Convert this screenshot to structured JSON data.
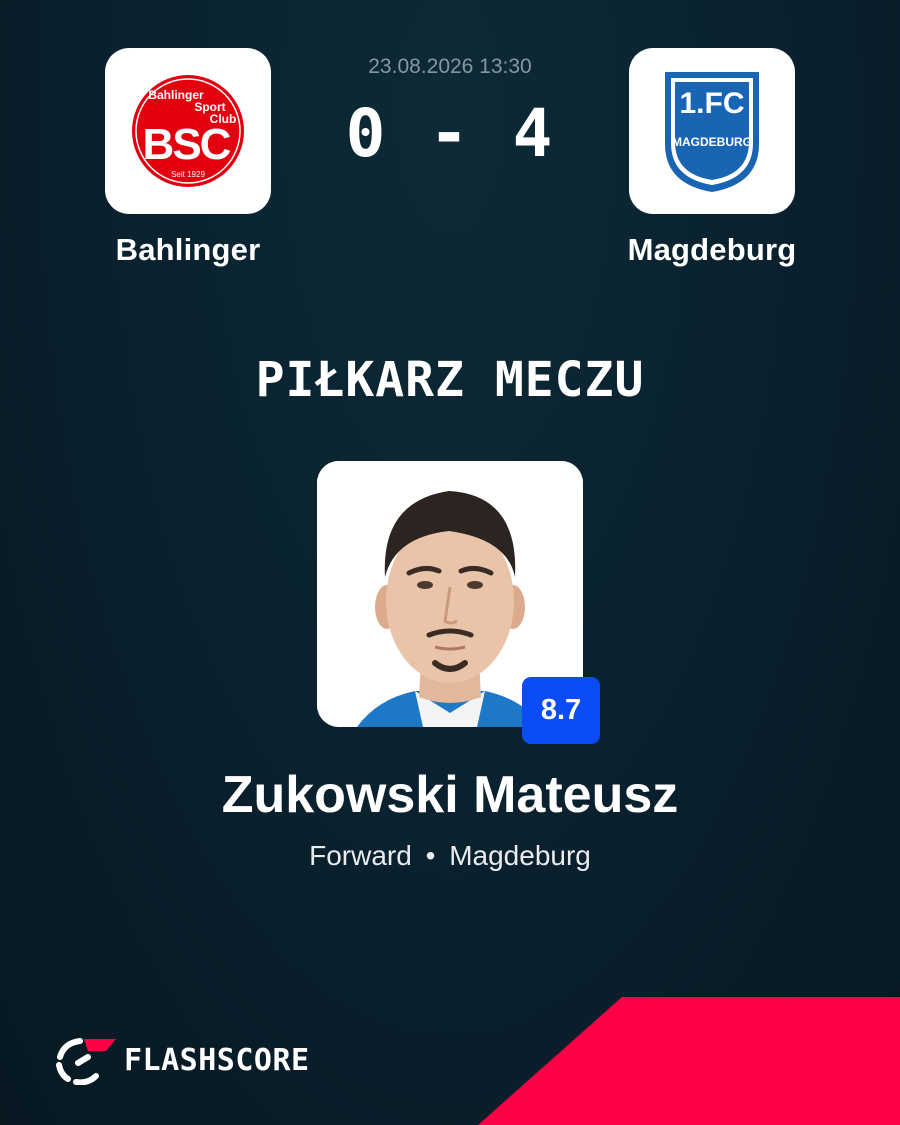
{
  "match": {
    "datetime": "23.08.2026 13:30",
    "score": "0 - 4",
    "home": {
      "name": "Bahlinger",
      "logo_top": "Bahlinger",
      "logo_sport": "Sport",
      "logo_club": "Club",
      "logo_letters": "BSC",
      "logo_bottom": "Seit 1929",
      "color": "#e3000f"
    },
    "away": {
      "name": "Magdeburg",
      "logo_top": "1.FC",
      "logo_side": "MAGDEBURG",
      "color": "#1a64b4"
    }
  },
  "title": "PIŁKARZ MECZU",
  "player": {
    "name": "Zukowski Mateusz",
    "rating": "8.7",
    "position": "Forward",
    "separator": "•",
    "team": "Magdeburg",
    "photo_icon": "player-portrait"
  },
  "brand": {
    "name": "FLASHSCORE",
    "accent": "#ff0046",
    "icon": "flashscore-logo-icon"
  },
  "colors": {
    "background": "#0a2230",
    "rating_badge": "#0b4cf5",
    "date_text": "#8797a0"
  }
}
